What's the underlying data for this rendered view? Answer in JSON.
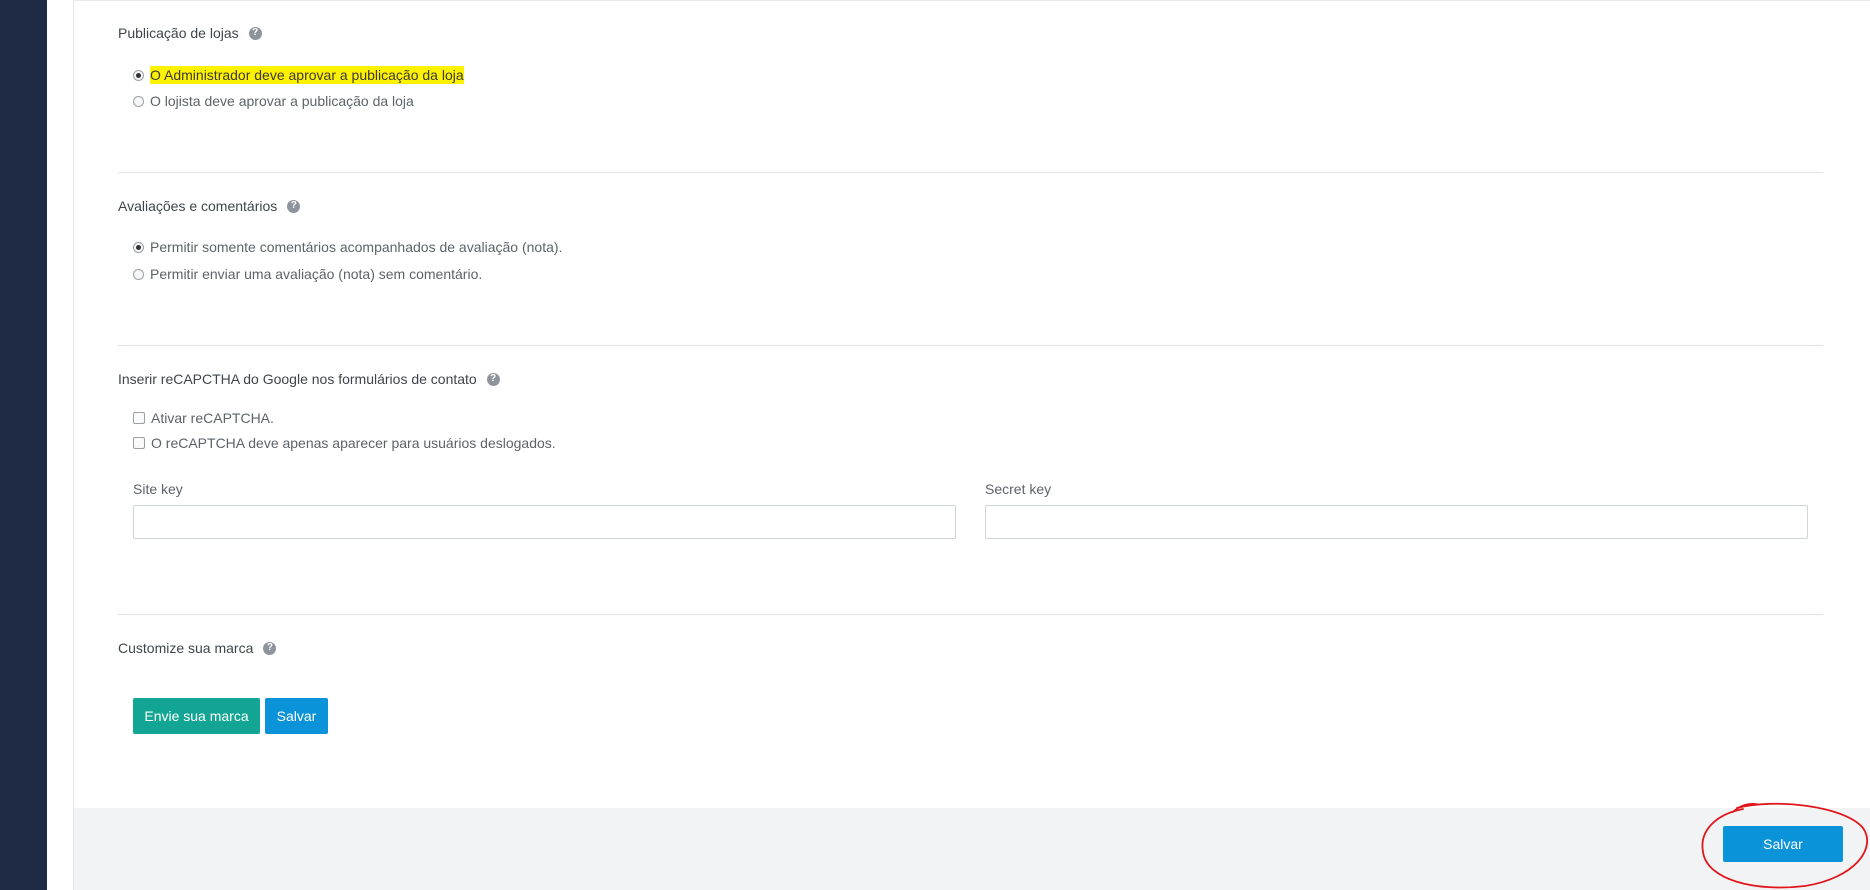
{
  "sections": {
    "store_publication": {
      "title": "Publicação de lojas",
      "options": [
        {
          "label": "O Administrador deve aprovar a publicação da loja",
          "selected": true,
          "highlighted": true
        },
        {
          "label": "O lojista deve aprovar a publicação da loja",
          "selected": false
        }
      ]
    },
    "reviews": {
      "title": "Avaliações e comentários",
      "options": [
        {
          "label": "Permitir somente comentários acompanhados de avaliação (nota).",
          "selected": true
        },
        {
          "label": "Permitir enviar uma avaliação (nota) sem comentário.",
          "selected": false
        }
      ]
    },
    "recaptcha": {
      "title": "Inserir reCAPCTHA do Google nos formulários de contato",
      "checkboxes": [
        {
          "label": "Ativar reCAPTCHA.",
          "checked": false
        },
        {
          "label": "O reCAPTCHA deve apenas aparecer para usuários deslogados.",
          "checked": false
        }
      ],
      "site_key_label": "Site key",
      "site_key_value": "",
      "secret_key_label": "Secret key",
      "secret_key_value": ""
    },
    "branding": {
      "title": "Customize sua marca",
      "upload_button": "Envie sua marca",
      "save_button": "Salvar"
    }
  },
  "footer": {
    "save_button": "Salvar"
  },
  "help_icon": "question-circle-icon",
  "colors": {
    "sidebar": "#1f2a44",
    "highlight": "#fff200",
    "teal_button": "#13a594",
    "blue_button": "#0b93d9",
    "annotation": "#e0161b"
  }
}
